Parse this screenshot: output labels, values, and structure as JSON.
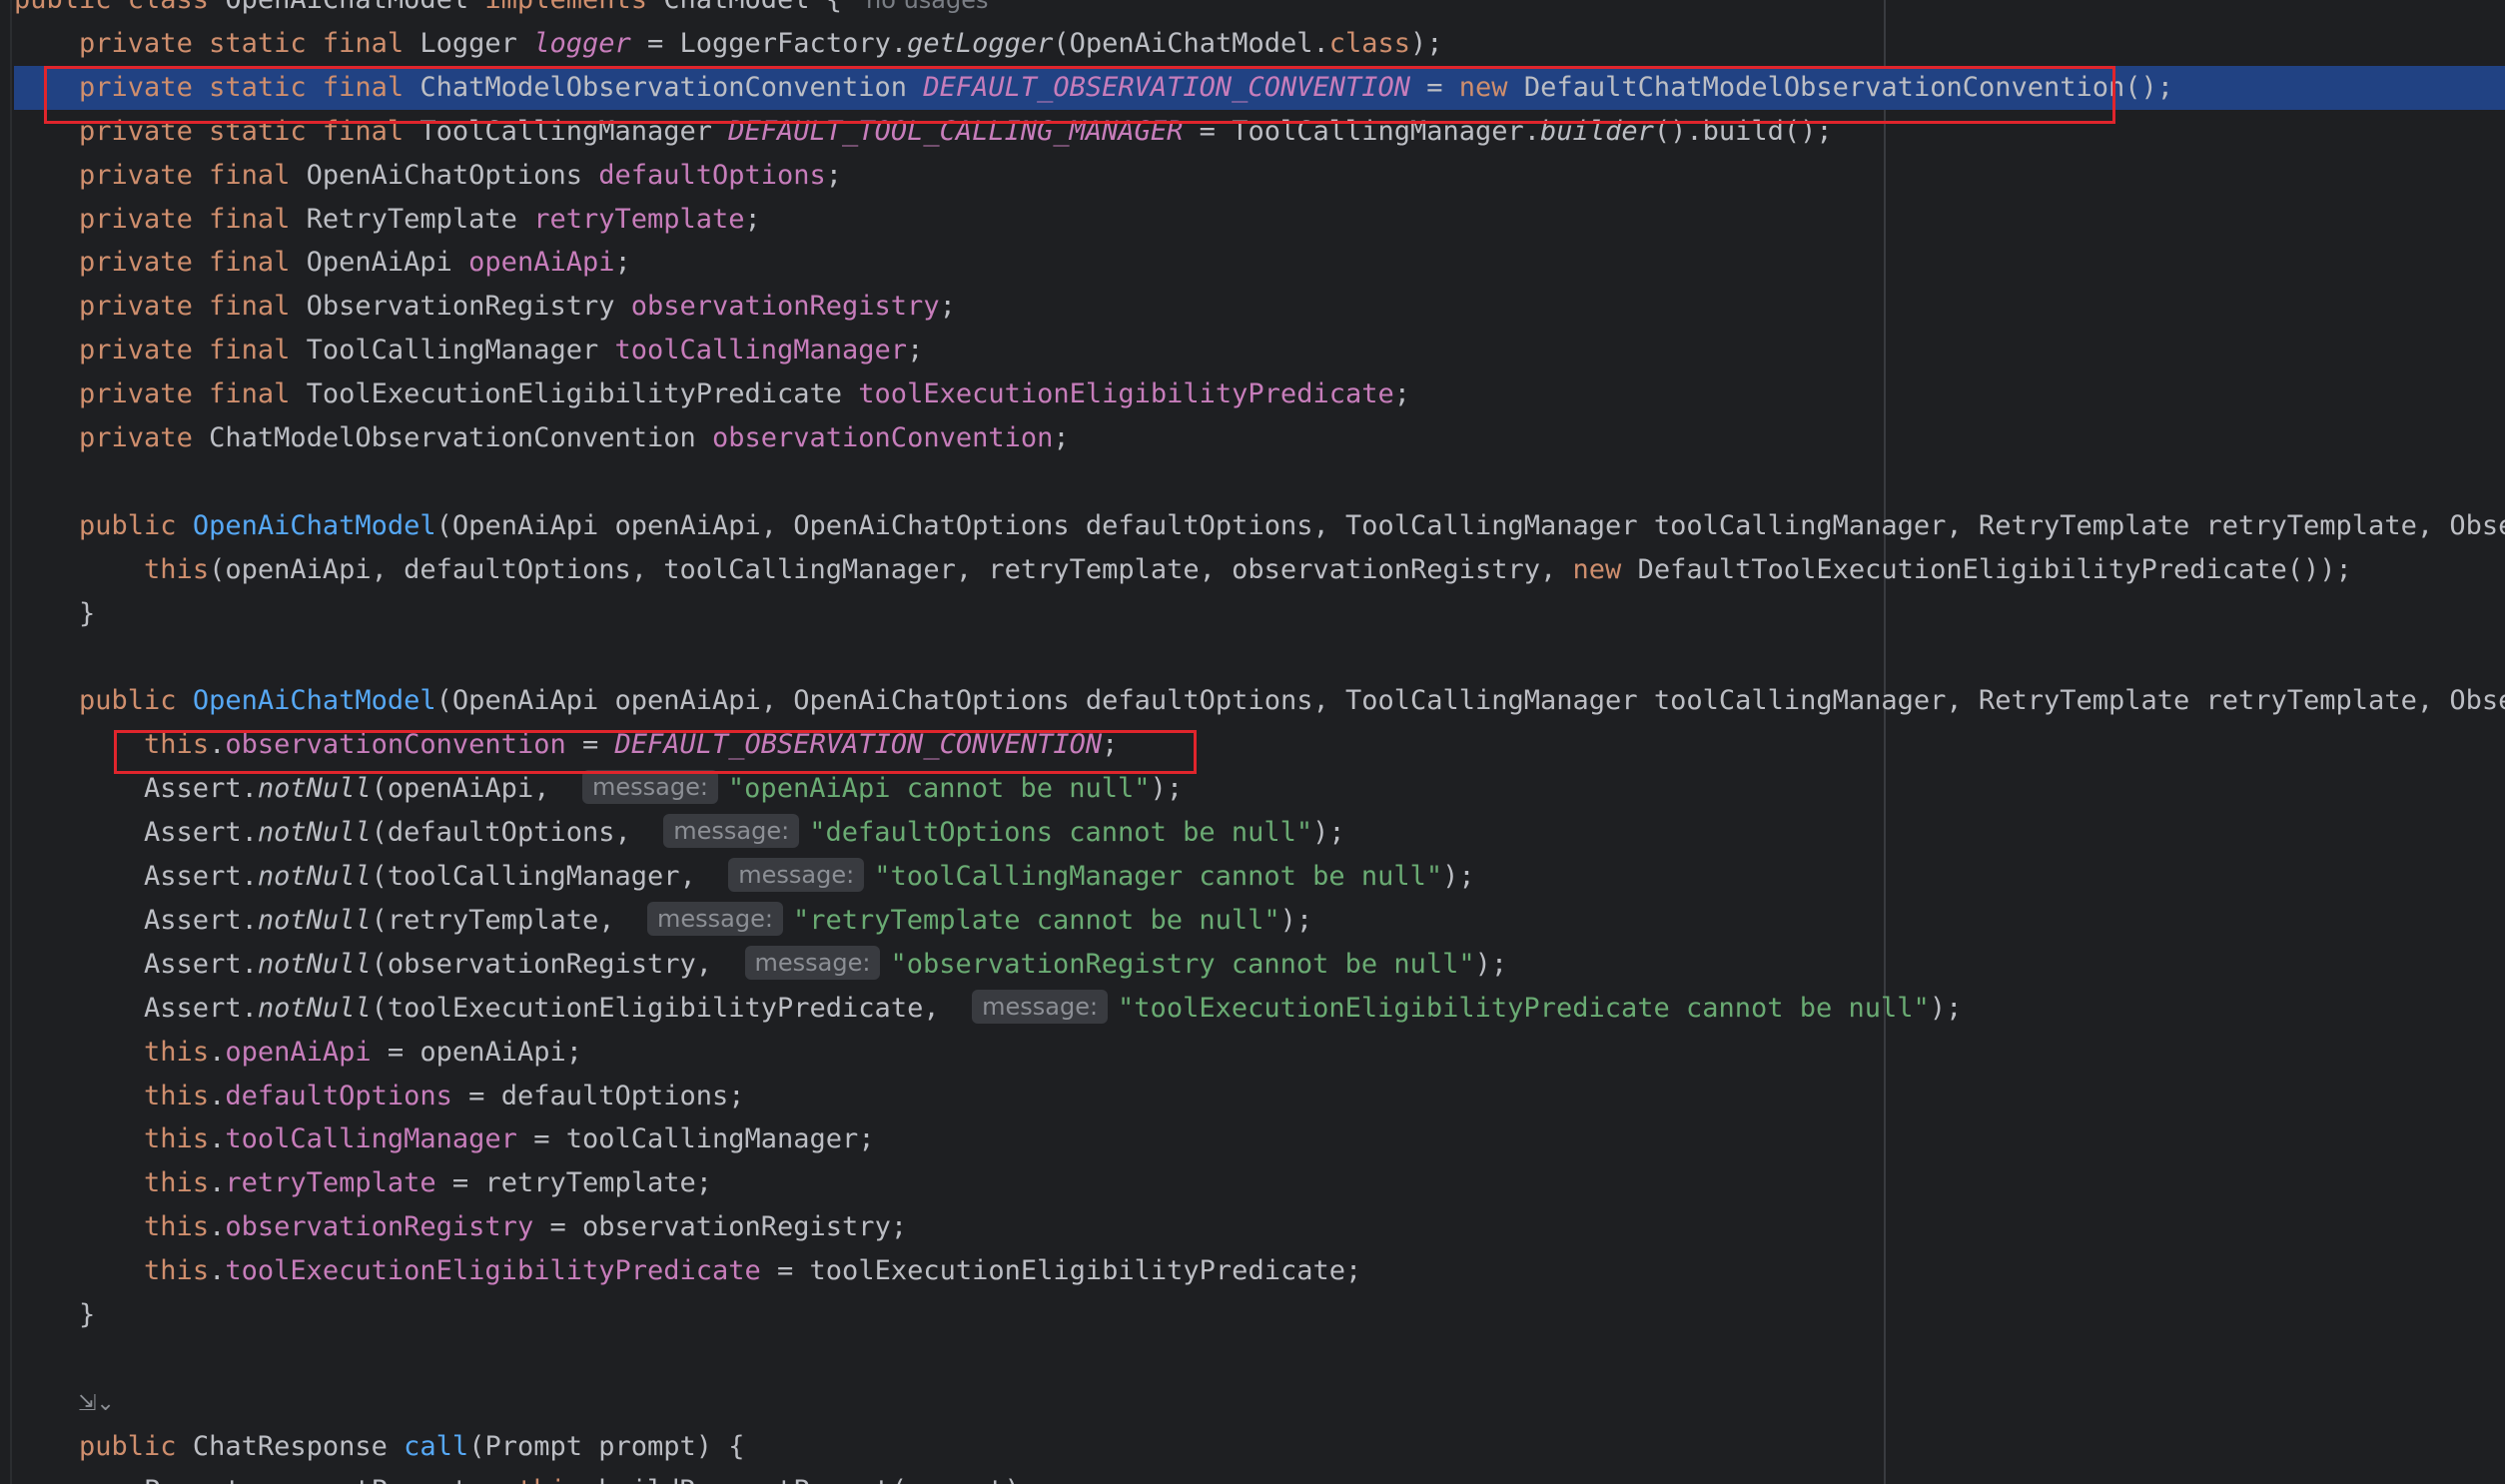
{
  "editor": {
    "language": "java",
    "highlighted_line_index": 2,
    "colors": {
      "background": "#1e1f22",
      "keyword": "#cf8e6d",
      "field": "#c77dbb",
      "method": "#56a8f5",
      "string": "#6aab73",
      "text": "#bcbec4",
      "selection": "#214283",
      "annotation_box": "#e0252c"
    },
    "lines": [
      {
        "t": [
          [
            "kw",
            "public class "
          ],
          [
            "tx",
            "OpenAiChatModel "
          ],
          [
            "kw",
            "implements "
          ],
          [
            "tx",
            "ChatModel {"
          ],
          [
            "usages",
            "no usages"
          ]
        ]
      },
      {
        "t": [
          [
            "tx",
            "    "
          ],
          [
            "kw",
            "private static final "
          ],
          [
            "tx",
            "Logger "
          ],
          [
            "fi",
            "logger"
          ],
          [
            "tx",
            " = LoggerFactory."
          ],
          [
            "it",
            "getLogger"
          ],
          [
            "tx",
            "(OpenAiChatModel."
          ],
          [
            "kw",
            "class"
          ],
          [
            "tx",
            ");"
          ]
        ]
      },
      {
        "t": [
          [
            "tx",
            "    "
          ],
          [
            "kw",
            "private static final "
          ],
          [
            "tx",
            "ChatModelObservationConvention "
          ],
          [
            "fi",
            "DEFAULT_OBSERVATION_CONVENTION"
          ],
          [
            "tx",
            " = "
          ],
          [
            "kw",
            "new "
          ],
          [
            "tx",
            "DefaultChatModelObservationConvention();"
          ]
        ]
      },
      {
        "t": [
          [
            "tx",
            "    "
          ],
          [
            "kw",
            "private static final "
          ],
          [
            "tx",
            "ToolCallingManager "
          ],
          [
            "fi",
            "DEFAULT_TOOL_CALLING_MANAGER"
          ],
          [
            "tx",
            " = ToolCallingManager."
          ],
          [
            "it",
            "builder"
          ],
          [
            "tx",
            "().build();"
          ]
        ]
      },
      {
        "t": [
          [
            "tx",
            "    "
          ],
          [
            "kw",
            "private final "
          ],
          [
            "tx",
            "OpenAiChatOptions "
          ],
          [
            "fld",
            "defaultOptions"
          ],
          [
            "tx",
            ";"
          ]
        ]
      },
      {
        "t": [
          [
            "tx",
            "    "
          ],
          [
            "kw",
            "private final "
          ],
          [
            "tx",
            "RetryTemplate "
          ],
          [
            "fld",
            "retryTemplate"
          ],
          [
            "tx",
            ";"
          ]
        ]
      },
      {
        "t": [
          [
            "tx",
            "    "
          ],
          [
            "kw",
            "private final "
          ],
          [
            "tx",
            "OpenAiApi "
          ],
          [
            "fld",
            "openAiApi"
          ],
          [
            "tx",
            ";"
          ]
        ]
      },
      {
        "t": [
          [
            "tx",
            "    "
          ],
          [
            "kw",
            "private final "
          ],
          [
            "tx",
            "ObservationRegistry "
          ],
          [
            "fld",
            "observationRegistry"
          ],
          [
            "tx",
            ";"
          ]
        ]
      },
      {
        "t": [
          [
            "tx",
            "    "
          ],
          [
            "kw",
            "private final "
          ],
          [
            "tx",
            "ToolCallingManager "
          ],
          [
            "fld",
            "toolCallingManager"
          ],
          [
            "tx",
            ";"
          ]
        ]
      },
      {
        "t": [
          [
            "tx",
            "    "
          ],
          [
            "kw",
            "private final "
          ],
          [
            "tx",
            "ToolExecutionEligibilityPredicate "
          ],
          [
            "fld",
            "toolExecutionEligibilityPredicate"
          ],
          [
            "tx",
            ";"
          ]
        ]
      },
      {
        "t": [
          [
            "tx",
            "    "
          ],
          [
            "kw",
            "private "
          ],
          [
            "tx",
            "ChatModelObservationConvention "
          ],
          [
            "fld",
            "observationConvention"
          ],
          [
            "tx",
            ";"
          ]
        ]
      },
      {
        "t": []
      },
      {
        "t": [
          [
            "tx",
            "    "
          ],
          [
            "kw",
            "public "
          ],
          [
            "fn",
            "OpenAiChatModel"
          ],
          [
            "tx",
            "(OpenAiApi openAiApi, OpenAiChatOptions defaultOptions, ToolCallingManager toolCallingManager, RetryTemplate retryTemplate, Observatio"
          ]
        ]
      },
      {
        "t": [
          [
            "tx",
            "        "
          ],
          [
            "kw",
            "this"
          ],
          [
            "tx",
            "(openAiApi, defaultOptions, toolCallingManager, retryTemplate, observationRegistry, "
          ],
          [
            "kw",
            "new "
          ],
          [
            "tx",
            "DefaultToolExecutionEligibilityPredicate());"
          ]
        ]
      },
      {
        "t": [
          [
            "tx",
            "    }"
          ]
        ]
      },
      {
        "t": []
      },
      {
        "t": [
          [
            "tx",
            "    "
          ],
          [
            "kw",
            "public "
          ],
          [
            "fn",
            "OpenAiChatModel"
          ],
          [
            "tx",
            "(OpenAiApi openAiApi, OpenAiChatOptions defaultOptions, ToolCallingManager toolCallingManager, RetryTemplate retryTemplate, Observatio"
          ]
        ]
      },
      {
        "t": [
          [
            "tx",
            "        "
          ],
          [
            "kw",
            "this"
          ],
          [
            "tx",
            "."
          ],
          [
            "fld",
            "observationConvention"
          ],
          [
            "tx",
            " = "
          ],
          [
            "fi",
            "DEFAULT_OBSERVATION_CONVENTION"
          ],
          [
            "tx",
            ";"
          ]
        ]
      },
      {
        "t": [
          [
            "tx",
            "        Assert."
          ],
          [
            "it",
            "notNull"
          ],
          [
            "tx",
            "(openAiApi,  "
          ],
          [
            "hint",
            "message:"
          ],
          [
            "str",
            "\"openAiApi cannot be null\""
          ],
          [
            "tx",
            ");"
          ]
        ]
      },
      {
        "t": [
          [
            "tx",
            "        Assert."
          ],
          [
            "it",
            "notNull"
          ],
          [
            "tx",
            "(defaultOptions,  "
          ],
          [
            "hint",
            "message:"
          ],
          [
            "str",
            "\"defaultOptions cannot be null\""
          ],
          [
            "tx",
            ");"
          ]
        ]
      },
      {
        "t": [
          [
            "tx",
            "        Assert."
          ],
          [
            "it",
            "notNull"
          ],
          [
            "tx",
            "(toolCallingManager,  "
          ],
          [
            "hint",
            "message:"
          ],
          [
            "str",
            "\"toolCallingManager cannot be null\""
          ],
          [
            "tx",
            ");"
          ]
        ]
      },
      {
        "t": [
          [
            "tx",
            "        Assert."
          ],
          [
            "it",
            "notNull"
          ],
          [
            "tx",
            "(retryTemplate,  "
          ],
          [
            "hint",
            "message:"
          ],
          [
            "str",
            "\"retryTemplate cannot be null\""
          ],
          [
            "tx",
            ");"
          ]
        ]
      },
      {
        "t": [
          [
            "tx",
            "        Assert."
          ],
          [
            "it",
            "notNull"
          ],
          [
            "tx",
            "(observationRegistry,  "
          ],
          [
            "hint",
            "message:"
          ],
          [
            "str",
            "\"observationRegistry cannot be null\""
          ],
          [
            "tx",
            ");"
          ]
        ]
      },
      {
        "t": [
          [
            "tx",
            "        Assert."
          ],
          [
            "it",
            "notNull"
          ],
          [
            "tx",
            "(toolExecutionEligibilityPredicate,  "
          ],
          [
            "hint",
            "message:"
          ],
          [
            "str",
            "\"toolExecutionEligibilityPredicate cannot be null\""
          ],
          [
            "tx",
            ");"
          ]
        ]
      },
      {
        "t": [
          [
            "tx",
            "        "
          ],
          [
            "kw",
            "this"
          ],
          [
            "tx",
            "."
          ],
          [
            "fld",
            "openAiApi"
          ],
          [
            "tx",
            " = openAiApi;"
          ]
        ]
      },
      {
        "t": [
          [
            "tx",
            "        "
          ],
          [
            "kw",
            "this"
          ],
          [
            "tx",
            "."
          ],
          [
            "fld",
            "defaultOptions"
          ],
          [
            "tx",
            " = defaultOptions;"
          ]
        ]
      },
      {
        "t": [
          [
            "tx",
            "        "
          ],
          [
            "kw",
            "this"
          ],
          [
            "tx",
            "."
          ],
          [
            "fld",
            "toolCallingManager"
          ],
          [
            "tx",
            " = toolCallingManager;"
          ]
        ]
      },
      {
        "t": [
          [
            "tx",
            "        "
          ],
          [
            "kw",
            "this"
          ],
          [
            "tx",
            "."
          ],
          [
            "fld",
            "retryTemplate"
          ],
          [
            "tx",
            " = retryTemplate;"
          ]
        ]
      },
      {
        "t": [
          [
            "tx",
            "        "
          ],
          [
            "kw",
            "this"
          ],
          [
            "tx",
            "."
          ],
          [
            "fld",
            "observationRegistry"
          ],
          [
            "tx",
            " = observationRegistry;"
          ]
        ]
      },
      {
        "t": [
          [
            "tx",
            "        "
          ],
          [
            "kw",
            "this"
          ],
          [
            "tx",
            "."
          ],
          [
            "fld",
            "toolExecutionEligibilityPredicate"
          ],
          [
            "tx",
            " = toolExecutionEligibilityPredicate;"
          ]
        ]
      },
      {
        "t": [
          [
            "tx",
            "    }"
          ]
        ]
      },
      {
        "t": []
      },
      {
        "t": []
      },
      {
        "t": [
          [
            "tx",
            "    "
          ],
          [
            "kw",
            "public "
          ],
          [
            "tx",
            "ChatResponse "
          ],
          [
            "fn",
            "call"
          ],
          [
            "tx",
            "(Prompt prompt) {"
          ]
        ]
      },
      {
        "t": [
          [
            "tx",
            "        Prompt requestPrompt = "
          ],
          [
            "kw",
            "this"
          ],
          [
            "tx",
            "."
          ],
          [
            "tx",
            "buildRequestPrompt(prompt);"
          ]
        ]
      }
    ],
    "gutter_icon": {
      "name": "implements-gutter-icon",
      "glyph": "⇲⌄"
    }
  }
}
